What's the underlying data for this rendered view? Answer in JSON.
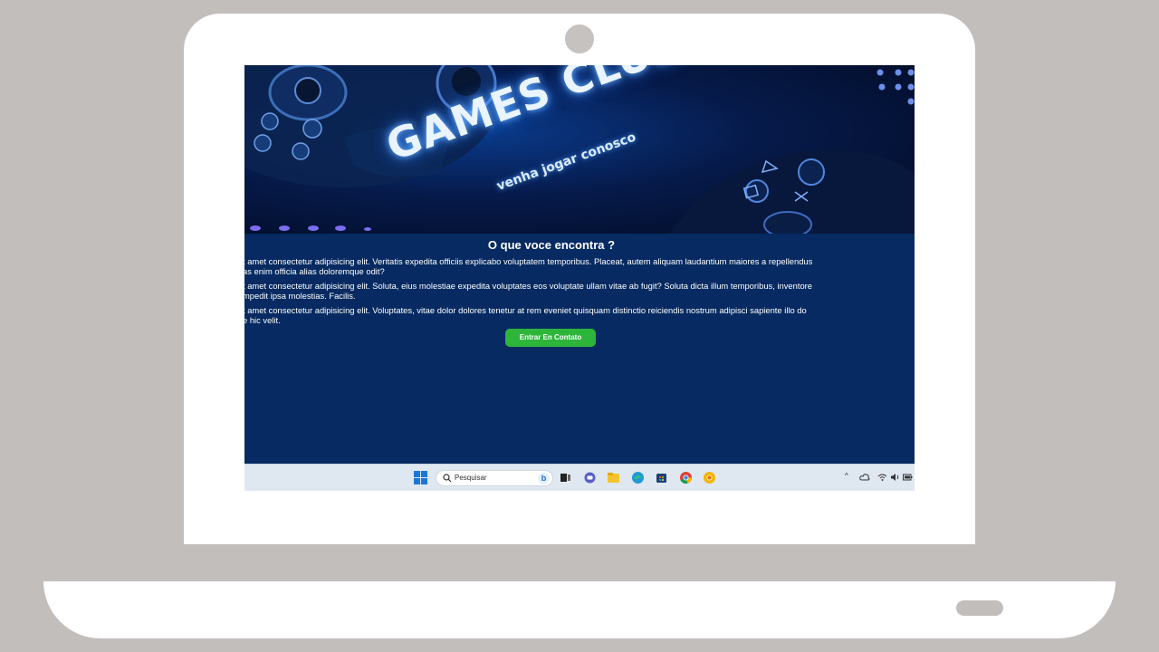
{
  "banner": {
    "title": "GAMES CLUB",
    "subtitle": "venha jogar conosco"
  },
  "section": {
    "heading": "O que voce encontra ?",
    "paragraphs": [
      {
        "line1": "t amet consectetur adipisicing elit. Veritatis expedita officiis explicabo voluptatem temporibus. Placeat, autem aliquam laudantium maiores a repellendus",
        "line2": "as enim officia alias doloremque odit?"
      },
      {
        "line1": "t amet consectetur adipisicing elit. Soluta, eius molestiae expedita voluptates eos voluptate ullam vitae ab fugit? Soluta dicta illum temporibus, inventore",
        "line2": "mpedit ipsa molestias. Facilis."
      },
      {
        "line1": "t amet consectetur adipisicing elit. Voluptates, vitae dolor dolores tenetur at rem eveniet quisquam distinctio reiciendis nostrum adipisci sapiente illo do",
        "line2": "e hic velit."
      }
    ],
    "cta_label": "Entrar En Contato"
  },
  "taskbar": {
    "search_placeholder": "Pesquisar",
    "bing_label": "b",
    "tray_up": "^"
  },
  "colors": {
    "page_bg": "#062a61",
    "cta_bg": "#2db53a",
    "outer_bg": "#c2bebc",
    "taskbar_bg": "#dfe7f1"
  },
  "icons": [
    "windows-start-icon",
    "search-icon",
    "bing-icon",
    "task-view-icon",
    "teams-chat-icon",
    "file-explorer-icon",
    "edge-icon",
    "store-icon",
    "chrome-icon",
    "chrome-canary-icon",
    "cloud-icon",
    "wifi-icon",
    "speaker-icon",
    "battery-icon"
  ]
}
